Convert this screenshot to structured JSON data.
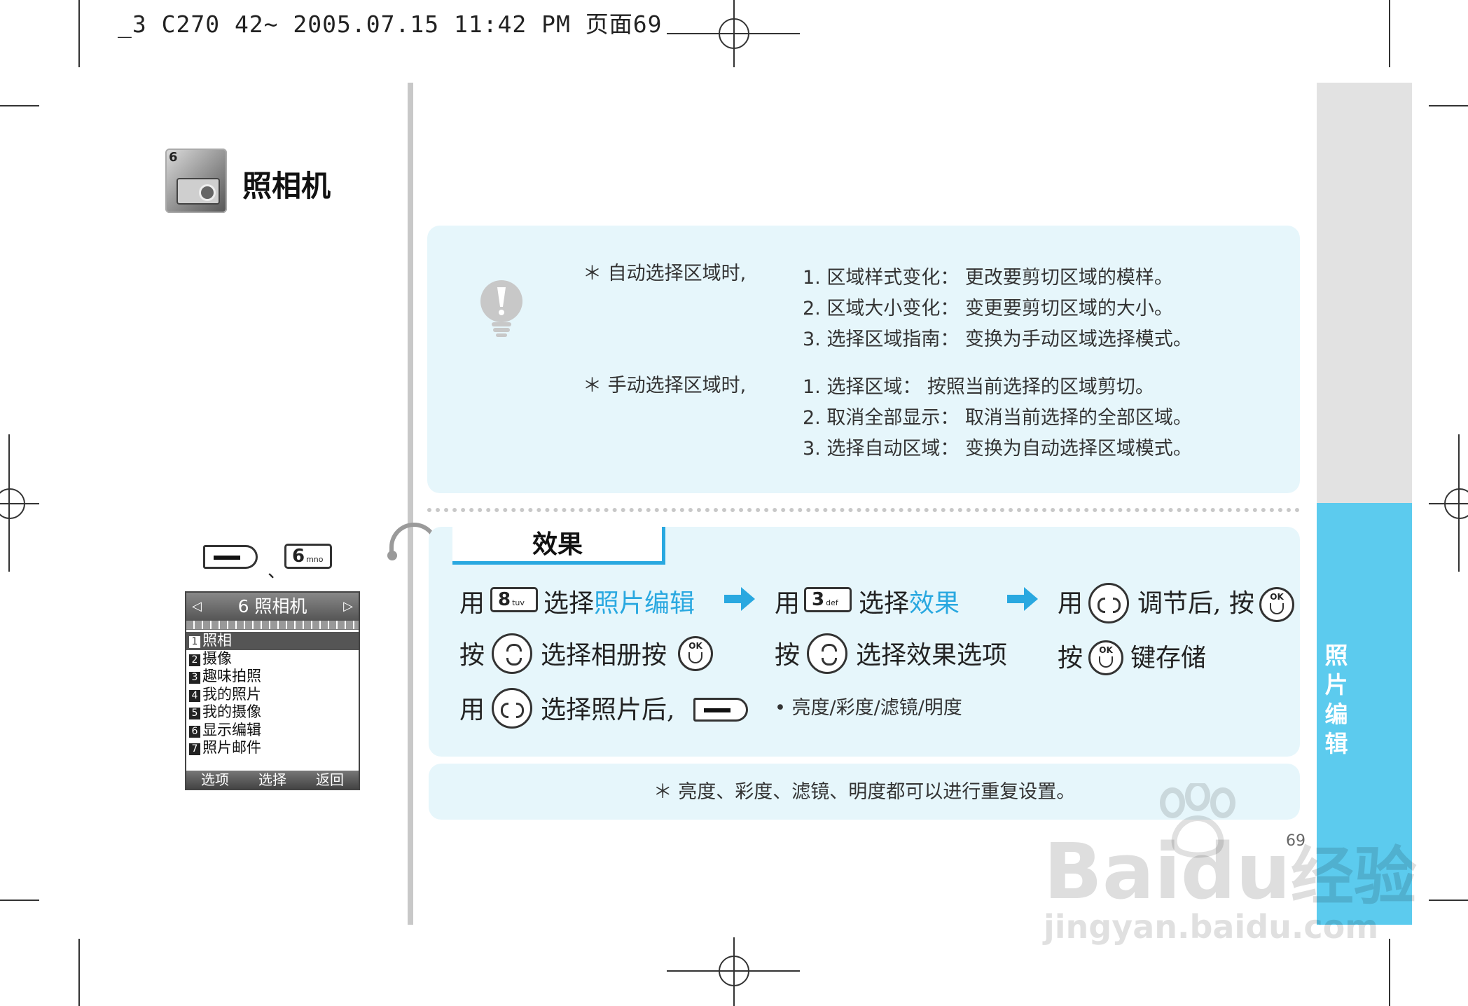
{
  "header": {
    "text": "_3 C270 42~ 2005.07.15 11:42 PM 页面69"
  },
  "section": {
    "number": "6",
    "title": "照相机"
  },
  "key_sep": "、",
  "numkey6": {
    "digit": "6",
    "letters": "mno"
  },
  "phone": {
    "title": "6 照相机",
    "left_arrow": "◁",
    "right_arrow": "▷",
    "items": [
      {
        "n": "1",
        "label": "照相"
      },
      {
        "n": "2",
        "label": "摄像"
      },
      {
        "n": "3",
        "label": "趣味拍照"
      },
      {
        "n": "4",
        "label": "我的照片"
      },
      {
        "n": "5",
        "label": "我的摄像"
      },
      {
        "n": "6",
        "label": "显示编辑"
      },
      {
        "n": "7",
        "label": "照片邮件"
      }
    ],
    "softkeys": {
      "left": "选项",
      "center": "选择",
      "right": "返回"
    }
  },
  "tip": {
    "auto": {
      "heading": "＊ 自动选择区域时,",
      "lines": [
        "1. 区域样式变化： 更改要剪切区域的模样。",
        "2. 区域大小变化： 变更要剪切区域的大小。",
        "3. 选择区域指南： 变换为手动区域选择模式。"
      ]
    },
    "manual": {
      "heading": "＊ 手动选择区域时,",
      "lines": [
        "1. 选择区域： 按照当前选择的区域剪切。",
        "2. 取消全部显示： 取消当前选择的全部区域。",
        "3. 选择自动区域： 变换为自动选择区域模式。"
      ]
    }
  },
  "effects": {
    "tab_label": "效果",
    "col1": {
      "r1_a": "用",
      "r1_key": "8",
      "r1_key_letters": "tuv",
      "r1_b": "选择",
      "r1_hl": "照片编辑",
      "r2_a": "按",
      "r2_b": "选择相册按",
      "r3_a": "用",
      "r3_b": "选择照片后,"
    },
    "col2": {
      "r1_a": "用",
      "r1_key": "3",
      "r1_key_letters": "def",
      "r1_b": "选择",
      "r1_hl": "效果",
      "r2_a": "按",
      "r2_b": "选择效果选项",
      "options": "• 亮度/彩度/滤镜/明度"
    },
    "col3": {
      "r1_a": "用",
      "r1_b": "调节后, 按",
      "r2_a": "按",
      "r2_b": "键存储"
    },
    "ok_label": "OK"
  },
  "note": "＊ 亮度、彩度、滤镜、明度都可以进行重复设置。",
  "side_tab": {
    "chars": [
      "照",
      "片",
      "编",
      "辑"
    ]
  },
  "page_number": "69",
  "watermark": {
    "brand": "Baidu",
    "brand_cn": "经验",
    "url": "jingyan.baidu.com"
  },
  "colors": {
    "accent": "#29a8e0",
    "panel": "#e6f6fb",
    "side_tab": "#5ccbee"
  }
}
